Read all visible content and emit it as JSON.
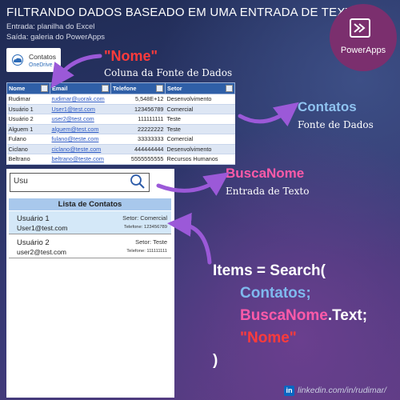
{
  "header": {
    "title": "FILTRANDO DADOS BASEADO EM UMA ENTRADA DE TEXTO.",
    "input_line": "Entrada: planilha do Excel",
    "output_line": "Saída: galeria do PowerApps"
  },
  "brand": {
    "name": "PowerApps",
    "accent": "#7b2f6e"
  },
  "source_card": {
    "title": "Contatos",
    "subtitle": "OneDrive -"
  },
  "annotations": {
    "nome_tag": "\"Nome\"",
    "nome_desc": "Coluna da Fonte de Dados",
    "contatos_tag": "Contatos",
    "contatos_desc": "Fonte de Dados",
    "busca_tag": "BuscaNome",
    "busca_desc": "Entrada de Texto"
  },
  "excel": {
    "columns": [
      "Nome",
      "Email",
      "Telefone",
      "Setor"
    ],
    "rows": [
      [
        "Rudimar",
        "rudimar@uorak.com",
        "5,548E+12",
        "Desenvolvimento"
      ],
      [
        "Usuário 1",
        "User1@test.com",
        "123456789",
        "Comercial"
      ],
      [
        "Usuário 2",
        "user2@test.com",
        "111111111",
        "Teste"
      ],
      [
        "Alguem 1",
        "alguem@test.com",
        "22222222",
        "Teste"
      ],
      [
        "Fulano",
        "fulano@teste.com",
        "33333333",
        "Comercial"
      ],
      [
        "Ciclano",
        "ciclano@teste.com",
        "444444444",
        "Desenvolvimento"
      ],
      [
        "Beltrano",
        "beltrano@teste.com",
        "5555555555",
        "Recursos Humanos"
      ]
    ]
  },
  "app": {
    "search_value": "Usu",
    "list_header": "Lista de Contatos",
    "items": [
      {
        "name": "Usuário 1",
        "email": "User1@test.com",
        "setor": "Setor: Comercial",
        "telefone": "Telefone: 123456789"
      },
      {
        "name": "Usuário 2",
        "email": "user2@test.com",
        "setor": "Setor: Teste",
        "telefone": "Telefone: 111111111"
      }
    ]
  },
  "formula": {
    "line1": "Items = Search(",
    "line2": "Contatos;",
    "line3_a": "BuscaNome",
    "line3_b": ".Text;",
    "line4": "\"Nome\"",
    "line5": ")"
  },
  "footer": {
    "linkedin_icon": "in",
    "linkedin": "linkedin.com/in/rudimar/"
  },
  "colors": {
    "arrow": "#9b59d8",
    "contatos": "#7fb9ee",
    "busca": "#ff5aa8",
    "nome": "#ff3b3b"
  }
}
